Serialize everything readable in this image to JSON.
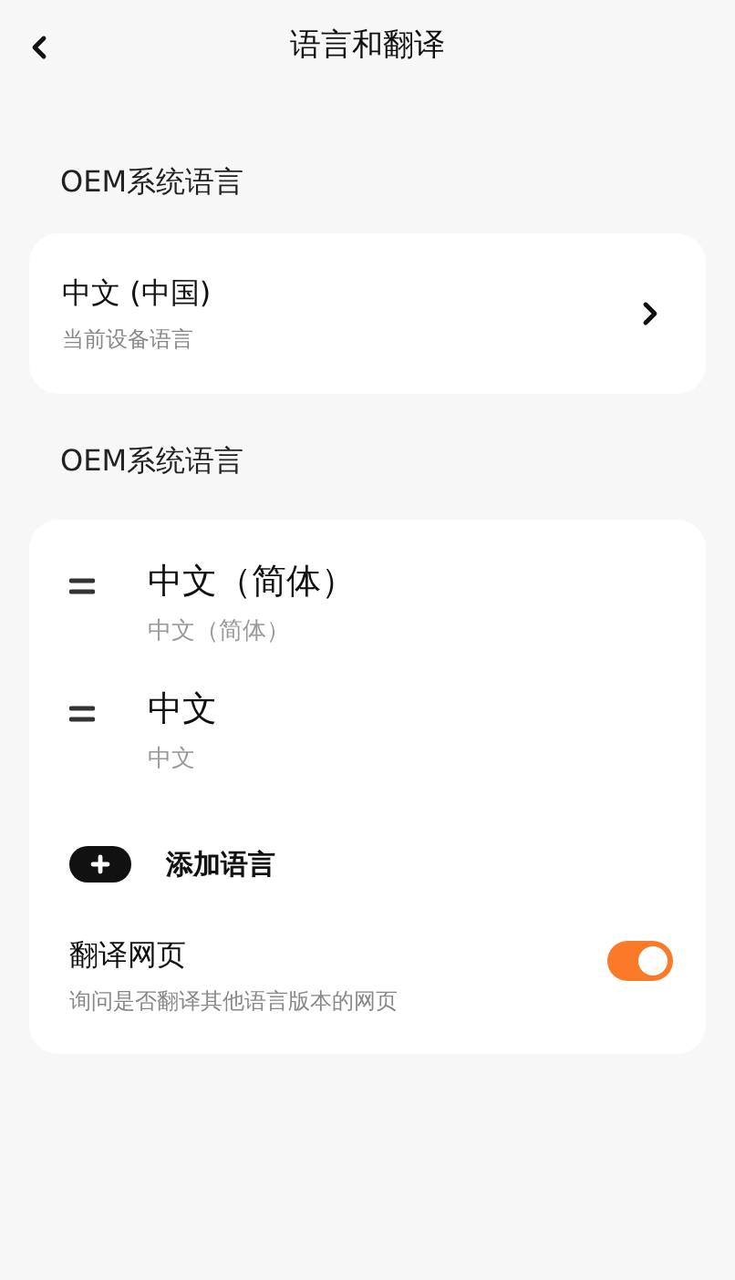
{
  "header": {
    "title": "语言和翻译"
  },
  "sections": [
    {
      "title": "OEM系统语言"
    },
    {
      "title": "OEM系统语言"
    }
  ],
  "current_language": {
    "label": "中文 (中国)",
    "description": "当前设备语言"
  },
  "languages": [
    {
      "name": "中文（简体）",
      "subtitle": "中文（简体）"
    },
    {
      "name": "中文",
      "subtitle": "中文"
    }
  ],
  "add_language": {
    "label": "添加语言"
  },
  "translate": {
    "label": "翻译网页",
    "description": "询问是否翻译其他语言版本的网页",
    "on": true
  }
}
